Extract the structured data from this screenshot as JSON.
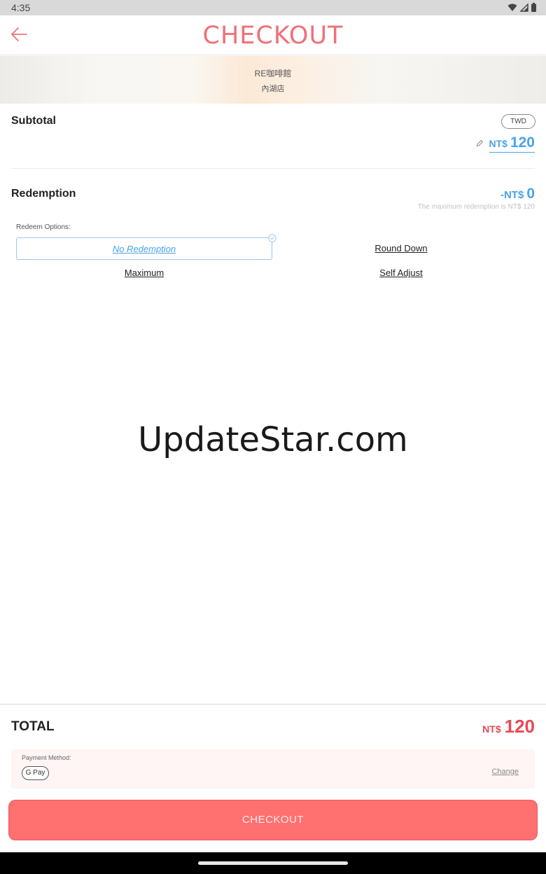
{
  "status_bar": {
    "time": "4:35",
    "icons": [
      "wifi-icon",
      "signal-icon",
      "battery-icon"
    ]
  },
  "header": {
    "title": "CHECKOUT",
    "back_icon": "arrow-left-icon"
  },
  "store": {
    "name": "RE咖啡館",
    "branch": "內湖店"
  },
  "subtotal": {
    "label": "Subtotal",
    "currency_badge": "TWD",
    "currency_symbol": "NT$",
    "amount": "120"
  },
  "redemption": {
    "label": "Redemption",
    "currency_symbol": "-NT$",
    "amount": "0",
    "max_note": "The maximum redemption is NT$ 120",
    "options_label": "Redeem Options:",
    "options": [
      {
        "label": "No Redemption",
        "selected": true
      },
      {
        "label": "Round Down",
        "selected": false
      },
      {
        "label": "Maximum",
        "selected": false
      },
      {
        "label": "Self Adjust",
        "selected": false
      }
    ]
  },
  "watermark": "UpdateStar.com",
  "total": {
    "label": "TOTAL",
    "currency_symbol": "NT$",
    "amount": "120"
  },
  "payment": {
    "label": "Payment Method:",
    "method": "G Pay",
    "change_label": "Change"
  },
  "checkout_button": {
    "label": "CHECKOUT"
  },
  "colors": {
    "accent": "#f07078",
    "blue": "#4aa3e8",
    "total_red": "#e64a55",
    "button": "#ff7070"
  }
}
